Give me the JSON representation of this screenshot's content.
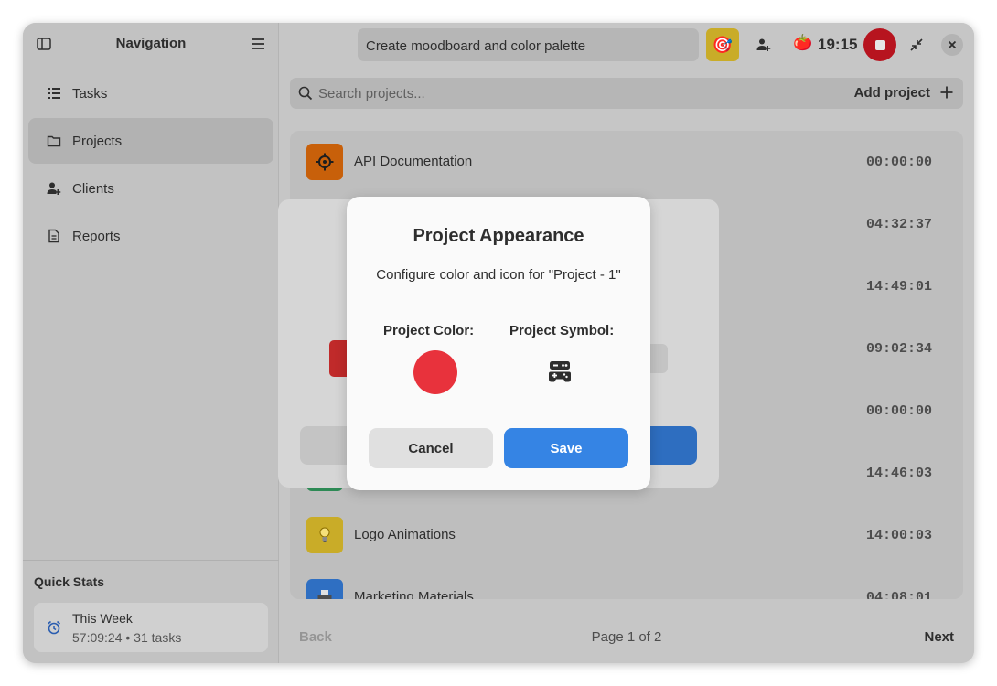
{
  "sidebar": {
    "title": "Navigation",
    "items": [
      {
        "label": "Tasks",
        "icon": "list-icon"
      },
      {
        "label": "Projects",
        "icon": "folder-icon"
      },
      {
        "label": "Clients",
        "icon": "user-add-icon"
      },
      {
        "label": "Reports",
        "icon": "document-icon"
      }
    ],
    "active_item": "Projects",
    "quick_stats": {
      "title": "Quick Stats",
      "period": "This Week",
      "summary": "57:09:24 • 31 tasks"
    }
  },
  "header": {
    "current_task": "Create moodboard and color palette",
    "goal_icon": "🎯",
    "timer_icon": "🍅",
    "timer": "19:15"
  },
  "search": {
    "placeholder": "Search projects...",
    "add_label": "Add project"
  },
  "projects": [
    {
      "name": "API Documentation",
      "time": "00:00:00",
      "color": "#c8600a",
      "icon": "crosshair-icon"
    },
    {
      "name": "",
      "time": "04:32:37"
    },
    {
      "name": "",
      "time": "14:49:01"
    },
    {
      "name": "",
      "time": "09:02:34"
    },
    {
      "name": "",
      "time": "00:00:00"
    },
    {
      "name": "",
      "time": "14:46:03",
      "color": "#2d8a55"
    },
    {
      "name": "Logo Animations",
      "time": "14:00:03",
      "color": "#c9ac28",
      "icon": "lightbulb-icon"
    },
    {
      "name": "Marketing Materials",
      "time": "04:08:01",
      "color": "#2f6fc2",
      "icon": "printer-icon"
    }
  ],
  "pagination": {
    "back": "Back",
    "page": "Page 1 of 2",
    "next": "Next"
  },
  "dialog": {
    "title": "Project Appearance",
    "subtitle": "Configure color and icon for \"Project - 1\"",
    "color_label": "Project Color:",
    "symbol_label": "Project Symbol:",
    "selected_color": "#e8323c",
    "selected_symbol": "gamepad-icon",
    "cancel": "Cancel",
    "save": "Save"
  }
}
